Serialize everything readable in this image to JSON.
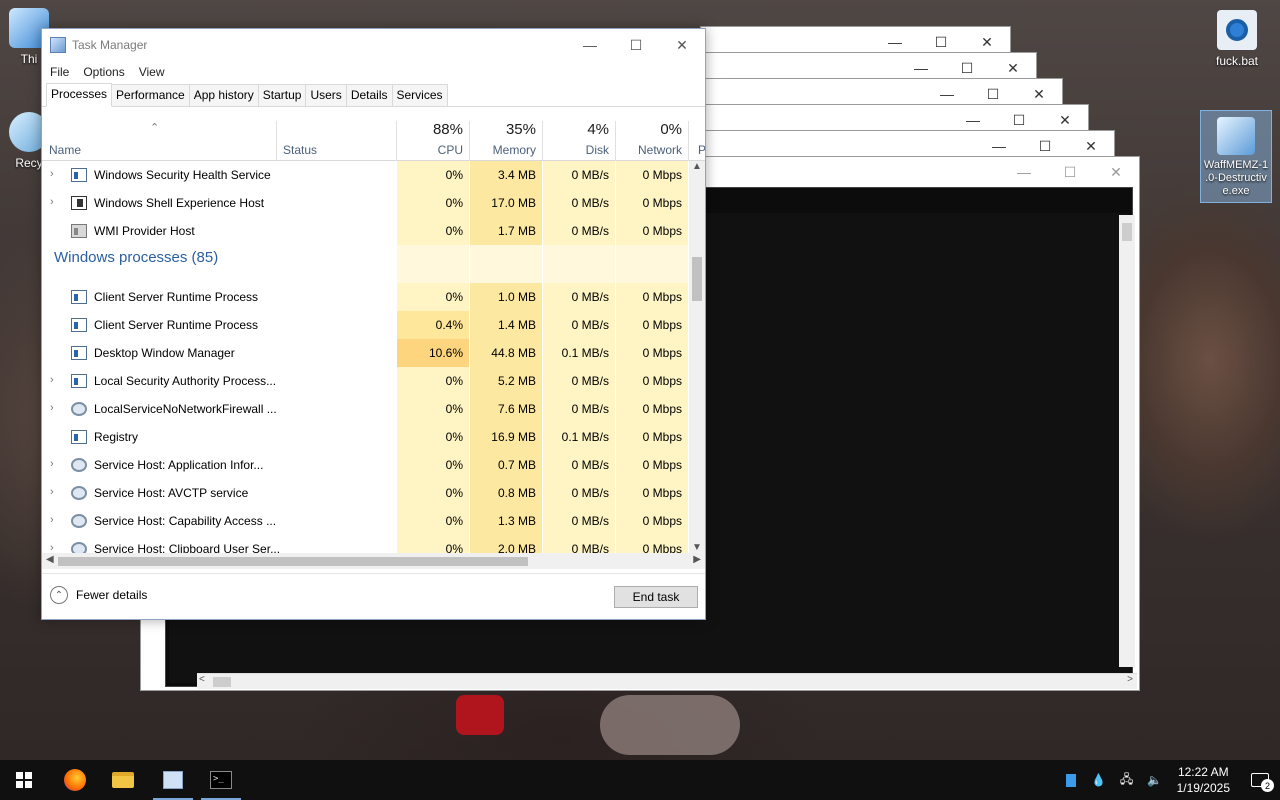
{
  "desktop": {
    "icons": [
      {
        "label": "Thi"
      },
      {
        "label": "Recy"
      },
      {
        "label": "fuck.bat"
      },
      {
        "label_lines": [
          "WaffMEMZ-1",
          ".0-Destructiv",
          "e.exe"
        ]
      }
    ]
  },
  "ghost_windows": {
    "minimize": "—",
    "maximize": "☐",
    "close": "✕"
  },
  "task_manager": {
    "title": "Task Manager",
    "window_controls": {
      "minimize": "—",
      "maximize": "☐",
      "close": "✕"
    },
    "menu": [
      "File",
      "Options",
      "View"
    ],
    "tabs": [
      "Processes",
      "Performance",
      "App history",
      "Startup",
      "Users",
      "Details",
      "Services"
    ],
    "active_tab": "Processes",
    "columns": {
      "name": "Name",
      "status": "Status",
      "cpu": {
        "pct": "88%",
        "label": "CPU"
      },
      "memory": {
        "pct": "35%",
        "label": "Memory"
      },
      "disk": {
        "pct": "4%",
        "label": "Disk"
      },
      "network": {
        "pct": "0%",
        "label": "Network"
      },
      "power_truncated": "P"
    },
    "rows": [
      {
        "name": "Windows Security Health Service",
        "expandable": true,
        "icon": "service-window-icon",
        "cpu": "0%",
        "memory": "3.4 MB",
        "disk": "0 MB/s",
        "network": "0 Mbps"
      },
      {
        "name": "Windows Shell Experience Host",
        "expandable": true,
        "icon": "shell-host-icon",
        "cpu": "0%",
        "memory": "17.0 MB",
        "disk": "0 MB/s",
        "network": "0 Mbps"
      },
      {
        "name": "WMI Provider Host",
        "expandable": false,
        "icon": "wmi-provider-icon",
        "cpu": "0%",
        "memory": "1.7 MB",
        "disk": "0 MB/s",
        "network": "0 Mbps"
      }
    ],
    "group": {
      "label": "Windows processes (85)"
    },
    "group_rows": [
      {
        "name": "Client Server Runtime Process",
        "expandable": false,
        "icon": "process-window-icon",
        "cpu": "0%",
        "memory": "1.0 MB",
        "disk": "0 MB/s",
        "network": "0 Mbps"
      },
      {
        "name": "Client Server Runtime Process",
        "expandable": false,
        "icon": "process-window-icon",
        "cpu": "0.4%",
        "memory": "1.4 MB",
        "disk": "0 MB/s",
        "network": "0 Mbps"
      },
      {
        "name": "Desktop Window Manager",
        "expandable": false,
        "icon": "process-window-icon",
        "cpu": "10.6%",
        "memory": "44.8 MB",
        "disk": "0.1 MB/s",
        "network": "0 Mbps"
      },
      {
        "name": "Local Security Authority Process...",
        "expandable": true,
        "icon": "process-window-icon",
        "cpu": "0%",
        "memory": "5.2 MB",
        "disk": "0 MB/s",
        "network": "0 Mbps"
      },
      {
        "name": "LocalServiceNoNetworkFirewall ...",
        "expandable": true,
        "icon": "service-gear-icon",
        "cpu": "0%",
        "memory": "7.6 MB",
        "disk": "0 MB/s",
        "network": "0 Mbps"
      },
      {
        "name": "Registry",
        "expandable": false,
        "icon": "process-window-icon",
        "cpu": "0%",
        "memory": "16.9 MB",
        "disk": "0.1 MB/s",
        "network": "0 Mbps"
      },
      {
        "name": "Service Host: Application Infor...",
        "expandable": true,
        "icon": "service-gear-icon",
        "cpu": "0%",
        "memory": "0.7 MB",
        "disk": "0 MB/s",
        "network": "0 Mbps"
      },
      {
        "name": "Service Host: AVCTP service",
        "expandable": true,
        "icon": "service-gear-icon",
        "cpu": "0%",
        "memory": "0.8 MB",
        "disk": "0 MB/s",
        "network": "0 Mbps"
      },
      {
        "name": "Service Host: Capability Access ...",
        "expandable": true,
        "icon": "service-gear-icon",
        "cpu": "0%",
        "memory": "1.3 MB",
        "disk": "0 MB/s",
        "network": "0 Mbps"
      },
      {
        "name": "Service Host: Clipboard User Ser...",
        "expandable": true,
        "icon": "service-gear-icon",
        "cpu": "0%",
        "memory": "2.0 MB",
        "disk": "0 MB/s",
        "network": "0 Mbps"
      }
    ],
    "footer": {
      "fewer_details": "Fewer details",
      "end_task": "End task"
    }
  },
  "taskbar": {
    "apps": [
      "start-button",
      "firefox",
      "file-explorer",
      "task-manager",
      "command-prompt"
    ],
    "clock": {
      "time": "12:22 AM",
      "date": "1/19/2025"
    },
    "notification_count": "2"
  },
  "colors": {
    "accent": "#2a5fa0",
    "heat_low": "#fff4c4",
    "heat_mid": "#fee69a",
    "heat_high": "#fdd57e"
  }
}
